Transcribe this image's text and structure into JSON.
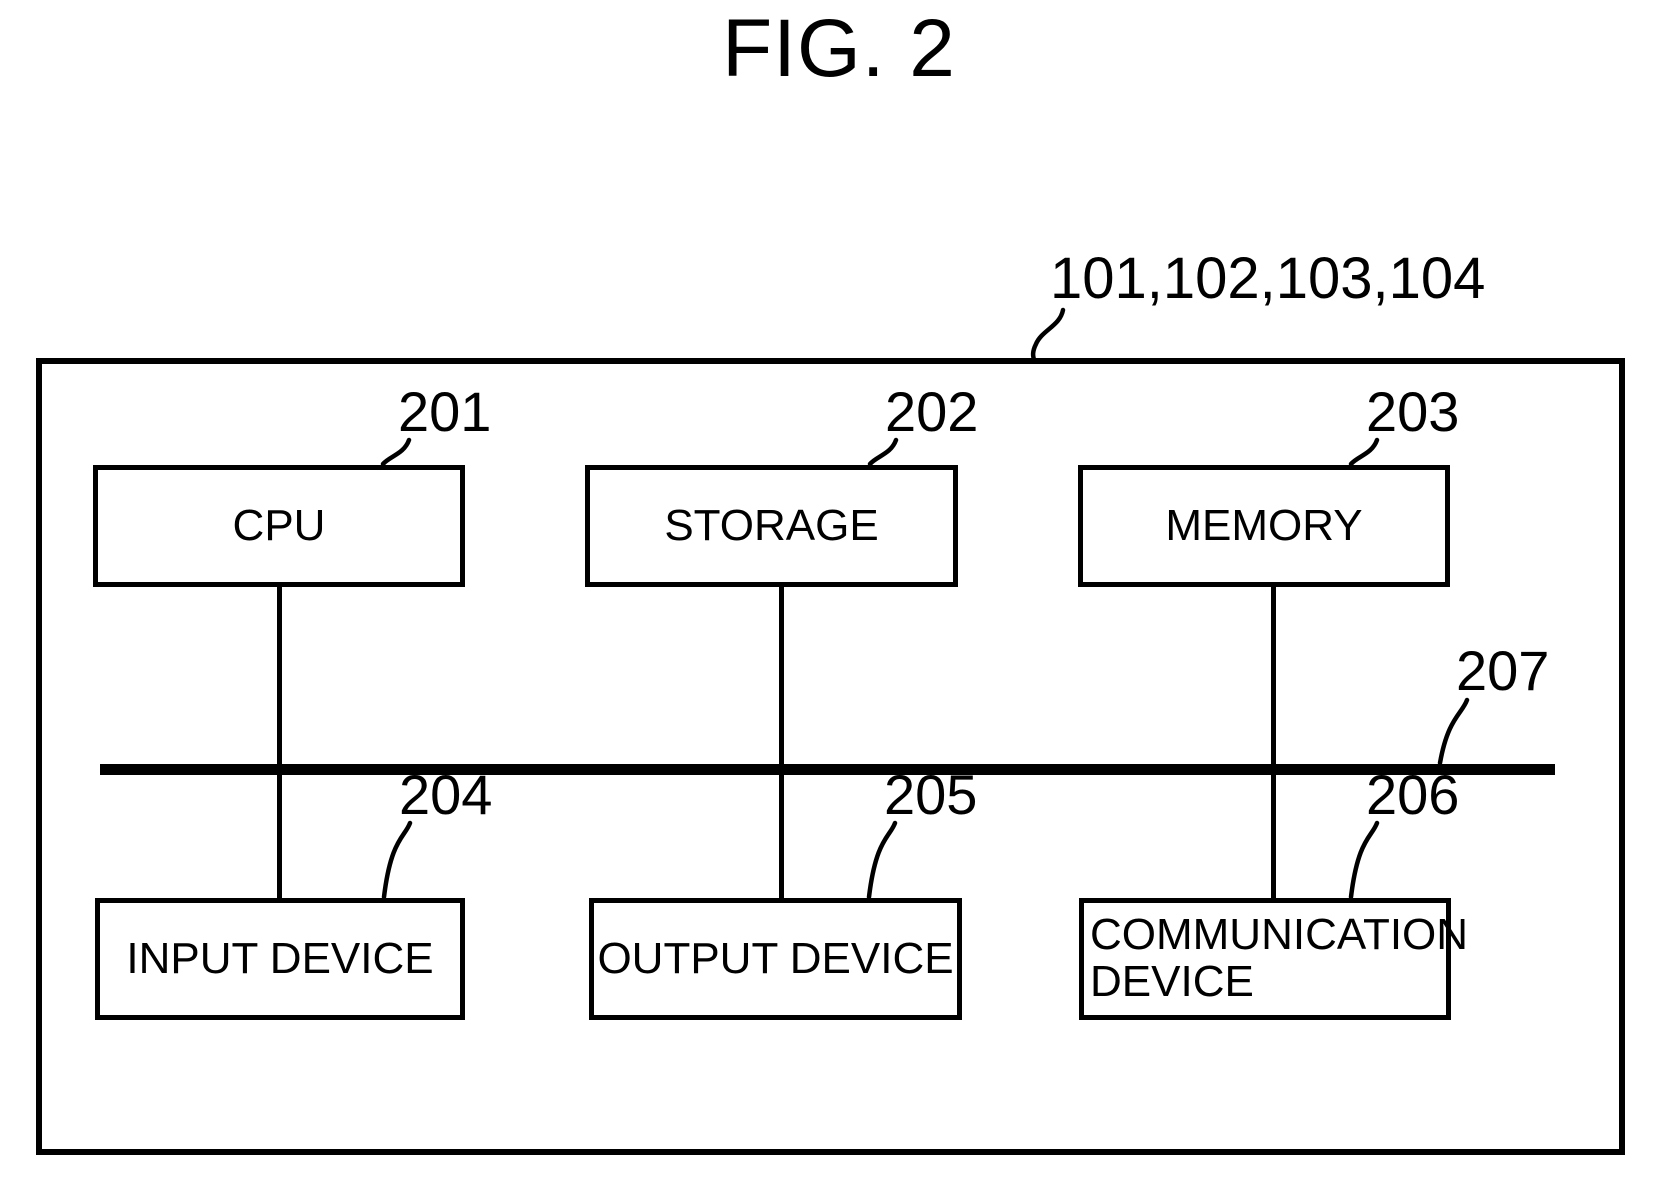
{
  "figure": {
    "title": "FIG. 2",
    "type": "patent-block-diagram",
    "description": "Hardware configuration block diagram of apparatuses 101, 102, 103, 104"
  },
  "enclosure": {
    "reference_numeral": "101,102,103,104"
  },
  "bus": {
    "reference_numeral": "207",
    "name": "system-bus"
  },
  "components": {
    "top_row": [
      {
        "id": "cpu",
        "label": "CPU",
        "reference_numeral": "201"
      },
      {
        "id": "storage",
        "label": "STORAGE",
        "reference_numeral": "202"
      },
      {
        "id": "memory",
        "label": "MEMORY",
        "reference_numeral": "203"
      }
    ],
    "bottom_row": [
      {
        "id": "input-device",
        "label": "INPUT DEVICE",
        "reference_numeral": "204"
      },
      {
        "id": "output-device",
        "label": "OUTPUT DEVICE",
        "reference_numeral": "205"
      },
      {
        "id": "communication-device",
        "label": "COMMUNICATION\nDEVICE",
        "reference_numeral": "206"
      }
    ]
  },
  "colors": {
    "ink": "#000000",
    "paper": "#ffffff"
  }
}
